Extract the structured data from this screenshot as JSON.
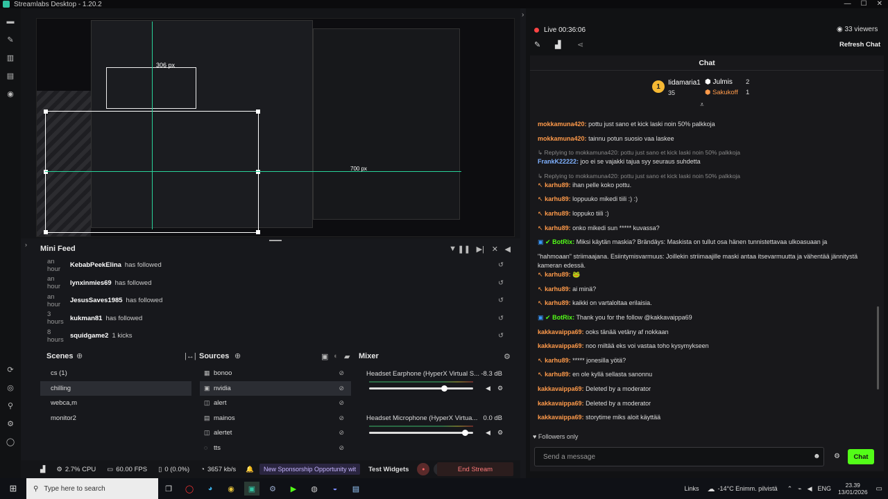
{
  "window": {
    "title": "Streamlabs Desktop - 1.20.2",
    "minimize": "—",
    "maximize": "☐",
    "close": "✕"
  },
  "preview": {
    "dimension_w": "306 px",
    "dimension_h": "700 px"
  },
  "minifeed": {
    "title": "Mini Feed",
    "rows": [
      {
        "time": "an hour",
        "name": "KebabPeekElina",
        "action": "has followed"
      },
      {
        "time": "an hour",
        "name": "lynxinmies69",
        "action": "has followed"
      },
      {
        "time": "an hour",
        "name": "JesusSaves1985",
        "action": "has followed"
      },
      {
        "time": "3 hours",
        "name": "kukman81",
        "action": "has followed"
      },
      {
        "time": "8 hours",
        "name": "squidgame2",
        "action": "1 kicks"
      }
    ]
  },
  "scenes": {
    "title": "Scenes",
    "items": [
      "cs (1)",
      "chilling",
      "webca,m",
      "monitor2"
    ],
    "selected": 1
  },
  "sources": {
    "title": "Sources",
    "items": [
      {
        "icon": "▦",
        "label": "bonoo"
      },
      {
        "icon": "▣",
        "label": "nvidia"
      },
      {
        "icon": "◫",
        "label": "alert"
      },
      {
        "icon": "▤",
        "label": "mainos"
      },
      {
        "icon": "◫",
        "label": "alertet"
      },
      {
        "icon": "◌",
        "label": "tts"
      }
    ],
    "selected": 1
  },
  "mixer": {
    "title": "Mixer",
    "items": [
      {
        "name": "Headset Earphone (HyperX Virtual S...",
        "db": "-8.3 dB",
        "level": 0.78
      },
      {
        "name": "Headset Microphone (HyperX Virtua...",
        "db": "0.0 dB",
        "level": 1.0
      }
    ]
  },
  "status": {
    "cpu": "2.7% CPU",
    "fps": "60.00 FPS",
    "dropped": "0 (0.0%)",
    "bitrate": "3657 kb/s",
    "sponsor": "New Sponsorship Opportunity wit",
    "test_widgets": "Test Widgets",
    "end_stream": "End Stream"
  },
  "live": {
    "status": "Live 00:36:06",
    "viewers": "33 viewers",
    "refresh": "Refresh Chat"
  },
  "chat": {
    "title": "Chat",
    "top": [
      {
        "rank": "1",
        "name": "Iidamaria1",
        "amount": "35"
      },
      {
        "rank": "",
        "name": "Julmis",
        "amount": "2"
      },
      {
        "rank": "",
        "name": "Sakukoff",
        "amount": "1"
      }
    ],
    "messages": [
      {
        "user": "mokkamuna420:",
        "text": "pottu just sano et kick laski noin 50% palkkoja",
        "color": "#ff9a4a",
        "reply": ""
      },
      {
        "user": "mokkamuna420:",
        "text": "tainnu potun suosio vaa laskee",
        "color": "#ff9a4a",
        "reply": ""
      },
      {
        "user": "FrankK22222:",
        "text": "joo ei se vajakki tajua syy seuraus suhdetta",
        "color": "#7fb1ff",
        "reply": "Replying to mokkamuna420: pottu just sano et kick laski noin 50% palkkoja"
      },
      {
        "user": "karhu89:",
        "text": "ihan pelle koko pottu.",
        "color": "#ff9a4a",
        "reply": "Replying to mokkamuna420: pottu just sano et kick laski noin 50% palkkoja"
      },
      {
        "user": "karhu89:",
        "text": "loppuuko mikedi tiili :) :)",
        "color": "#ff9a4a",
        "reply": ""
      },
      {
        "user": "karhu89:",
        "text": "loppuko tiili :)",
        "color": "#ff9a4a",
        "reply": ""
      },
      {
        "user": "karhu89:",
        "text": "onko mikedi sun ***** kuvassa?",
        "color": "#ff9a4a",
        "reply": ""
      },
      {
        "user": "BotRix:",
        "text": "Miksi käytän maskia? Brändäys: Maskista on tullut osa hänen tunnistettavaa ulkoasuaan ja",
        "color": "#53fc18",
        "reply": ""
      },
      {
        "user": "",
        "text": "\"hahmoaan\" striimaajana. Esiintymisvarmuus: Joillekin striimaajille maski antaa itsevarmuutta ja vähentää jännitystä",
        "color": "",
        "reply": ""
      },
      {
        "user": "",
        "text": "kameran edessä.",
        "color": "",
        "reply": ""
      },
      {
        "user": "karhu89:",
        "text": "🐸",
        "color": "#ff9a4a",
        "reply": ""
      },
      {
        "user": "karhu89:",
        "text": "ai minä?",
        "color": "#ff9a4a",
        "reply": ""
      },
      {
        "user": "karhu89:",
        "text": "kaikki on vartaloltaa erilaisia.",
        "color": "#ff9a4a",
        "reply": ""
      },
      {
        "user": "BotRix:",
        "text": "Thank you for the follow @kakkavaippa69",
        "color": "#53fc18",
        "reply": ""
      },
      {
        "user": "kakkavaippa69:",
        "text": "ooks tänää vetäny af nokkaan",
        "color": "#ff9a4a",
        "reply": ""
      },
      {
        "user": "kakkavaippa69:",
        "text": "noo miltää eks voi vastaa toho kysymykseen",
        "color": "#ff9a4a",
        "reply": ""
      },
      {
        "user": "karhu89:",
        "text": "***** jonesilla yötä?",
        "color": "#ff9a4a",
        "reply": ""
      },
      {
        "user": "karhu89:",
        "text": "en ole kyllä sellasta sanonnu",
        "color": "#ff9a4a",
        "reply": ""
      },
      {
        "user": "kakkavaippa69:",
        "text": "Deleted by a moderator",
        "color": "#ff9a4a",
        "reply": ""
      },
      {
        "user": "kakkavaippa69:",
        "text": "Deleted by a moderator",
        "color": "#ff9a4a",
        "reply": ""
      },
      {
        "user": "kakkavaippa69:",
        "text": "storytime miks aloit käyttää",
        "color": "#ff9a4a",
        "reply": ""
      }
    ],
    "followers_only": "Followers only",
    "placeholder": "Send a message",
    "send": "Chat"
  },
  "taskbar": {
    "search": "Type here to search",
    "links": "Links",
    "weather": "-14°C  Enimm. pilvistä",
    "lang": "ENG",
    "time": "23.39",
    "date": "13/01/2026"
  },
  "colors": {
    "accent": "#53fc18",
    "live": "#ff4444",
    "teal": "#31c3a2"
  }
}
